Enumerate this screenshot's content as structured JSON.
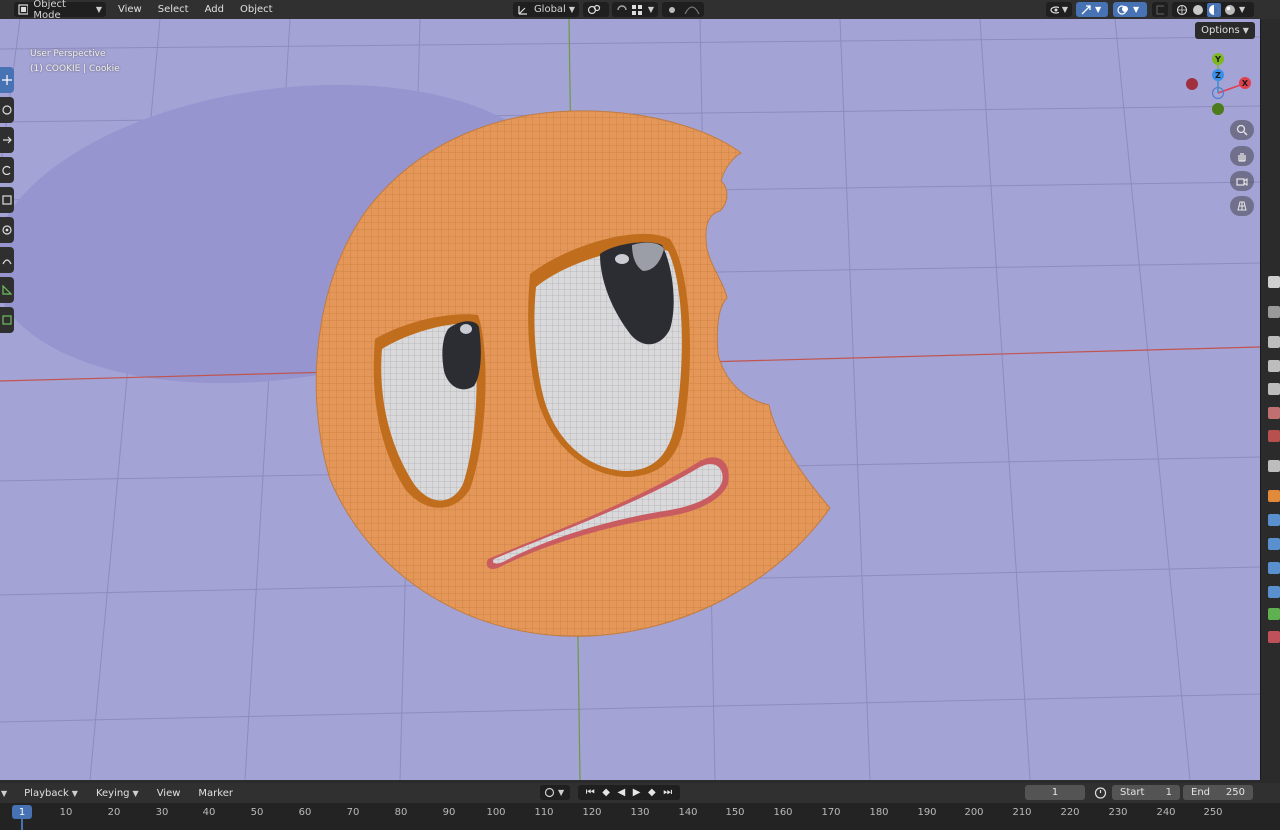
{
  "header": {
    "mode_label": "Object Mode",
    "menus": [
      "View",
      "Select",
      "Add",
      "Object"
    ],
    "transform_orientation": "Global",
    "options_label": "Options"
  },
  "viewport": {
    "perspective_label": "User Perspective",
    "object_label": "(1) COOKIE | Cookie",
    "background_color": "#a4a3d6",
    "object_color": "#e49758",
    "gizmo": {
      "x": "X",
      "y": "Y",
      "z": "Z",
      "x_color": "#e0404e",
      "y_color": "#7fb623",
      "z_color": "#3a8fe8"
    }
  },
  "icons": [
    "object-mode-icon",
    "transform-orientation-icon",
    "pivot-icon",
    "snap-icon",
    "snap-increment-icon",
    "proportional-icon",
    "visibility-icon",
    "gizmo-icon",
    "overlay-icon",
    "shading-wireframe-icon",
    "shading-solid-icon",
    "shading-material-icon",
    "shading-rendered-icon",
    "select-box-icon",
    "cursor-icon",
    "move-icon",
    "rotate-icon",
    "scale-icon",
    "transform-icon",
    "annotate-icon",
    "measure-icon",
    "add-cube-icon",
    "zoom-icon",
    "hand-pan-icon",
    "camera-icon",
    "grid-icon",
    "play-icon",
    "jump-start-icon",
    "keyframe-prev-icon",
    "play-reverse-icon",
    "keyframe-next-icon",
    "jump-end-icon",
    "stopwatch-icon"
  ],
  "timeline": {
    "menus": [
      "Playback",
      "Keying",
      "View",
      "Marker"
    ],
    "current_frame": "1",
    "start_label": "Start",
    "start_value": "1",
    "end_label": "End",
    "end_value": "250",
    "current_frame_badge": "1",
    "ticks": [
      "10",
      "20",
      "30",
      "40",
      "50",
      "60",
      "70",
      "80",
      "90",
      "100",
      "110",
      "120",
      "130",
      "140",
      "150",
      "160",
      "170",
      "180",
      "190",
      "200",
      "210",
      "220",
      "230",
      "240",
      "250"
    ]
  }
}
